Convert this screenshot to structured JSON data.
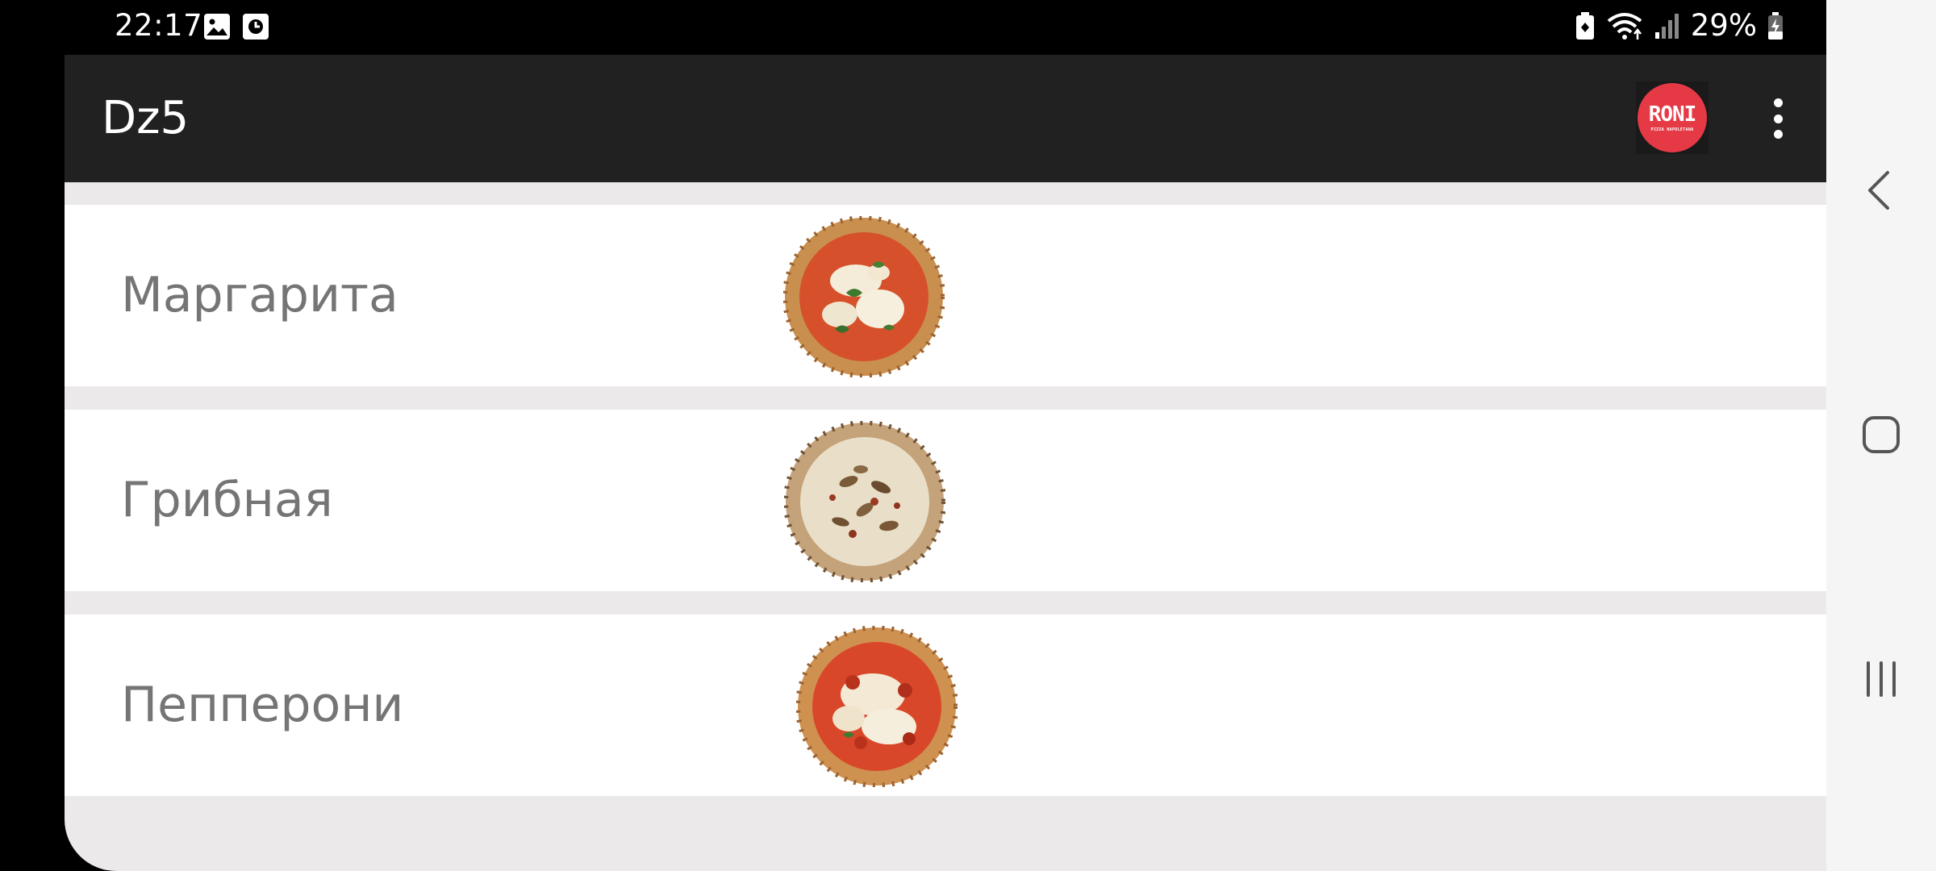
{
  "status_bar": {
    "time": "22:17",
    "left_icons": [
      "gallery-icon",
      "clock-icon"
    ],
    "right_icons": [
      "battery-saver-icon",
      "wifi-icon",
      "signal-icon",
      "battery-icon"
    ],
    "battery_percent": "29%"
  },
  "app_bar": {
    "title": "Dz5",
    "logo_text": "RONI",
    "logo_subtext": "PIZZA NAPOLETANA",
    "menu_icon": "more-vert-icon"
  },
  "pizzas": [
    {
      "name": "Маргарита",
      "image": "margherita-pizza-image"
    },
    {
      "name": "Грибная",
      "image": "mushroom-pizza-image"
    },
    {
      "name": "Пепперони",
      "image": "pepperoni-pizza-image"
    }
  ],
  "nav_bar": {
    "buttons": [
      "back-icon",
      "home-icon",
      "recents-icon"
    ]
  },
  "colors": {
    "app_bar": "#212121",
    "list_background": "#ebe9ea",
    "item_background": "#ffffff",
    "item_text": "#757575",
    "logo_red": "#e63946"
  }
}
